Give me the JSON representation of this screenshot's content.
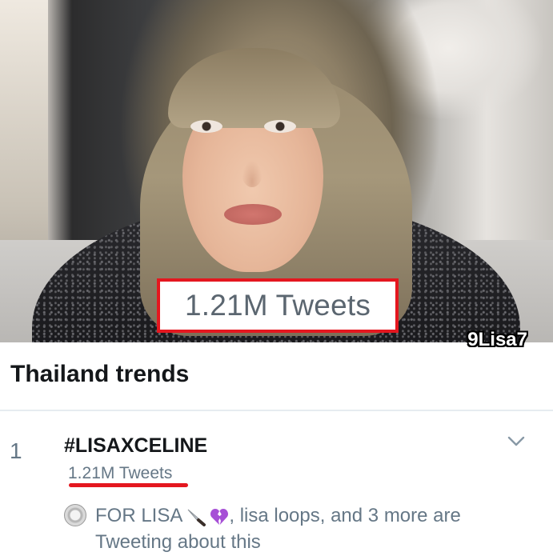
{
  "photo": {
    "highlight_text": "1.21M Tweets",
    "watermark": "9Lisa7"
  },
  "trends": {
    "section_title": "Thailand trends",
    "items": [
      {
        "rank": "1",
        "hashtag": "#LISAXCELINE",
        "tweet_count": "1.21M Tweets",
        "context_part1": "FOR LISA",
        "context_part2": ", lisa loops, and 3 more are Tweeting about this"
      }
    ]
  },
  "icons": {
    "chevron": "chevron-down-icon",
    "avatar": "avatar",
    "knife": "knife-emoji-icon",
    "broken_heart": "broken-heart-emoji-icon"
  },
  "colors": {
    "highlight_red": "#e4171f",
    "text_primary": "#14171a",
    "text_secondary": "#657786"
  }
}
